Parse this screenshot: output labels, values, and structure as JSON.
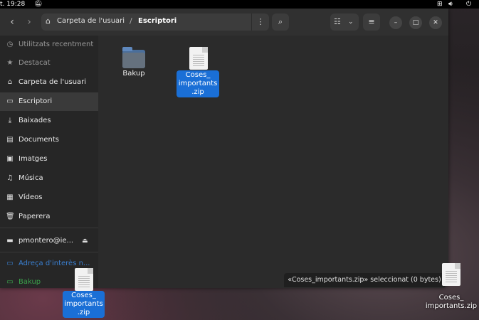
{
  "topbar": {
    "clock": "t. 19:28",
    "icons": [
      "bell-off-icon",
      "network-icon",
      "volume-icon",
      "power-icon"
    ]
  },
  "header": {
    "back_icon": "chevron-left-icon",
    "forward_icon": "chevron-right-icon",
    "breadcrumb": {
      "home_icon": "home-icon",
      "parent": "Carpeta de l'usuari",
      "separator": "/",
      "current": "Escriptori",
      "menu_icon": "kebab-icon"
    },
    "search_icon": "search-icon",
    "view_icon": "list-view-icon",
    "view_dropdown_icon": "chevron-down-icon",
    "menu_icon": "hamburger-icon",
    "window_controls": {
      "minimize": "–",
      "maximize": "□",
      "close": "✕"
    }
  },
  "sidebar": {
    "items": [
      {
        "label": "Utilitzats recentment",
        "icon": "recent-icon"
      },
      {
        "label": "Destacat",
        "icon": "star-icon"
      },
      {
        "label": "Carpeta de l'usuari",
        "icon": "home-icon"
      },
      {
        "label": "Escriptori",
        "icon": "desktop-icon"
      },
      {
        "label": "Baixades",
        "icon": "download-icon"
      },
      {
        "label": "Documents",
        "icon": "document-icon"
      },
      {
        "label": "Imatges",
        "icon": "image-icon"
      },
      {
        "label": "Música",
        "icon": "music-icon"
      },
      {
        "label": "Vídeos",
        "icon": "video-icon"
      },
      {
        "label": "Paperera",
        "icon": "trash-icon"
      }
    ],
    "mount": {
      "label": "pmontero@ie...",
      "icon": "drive-icon",
      "eject_icon": "eject-icon"
    },
    "network": {
      "label": "Adreça d'interès n...",
      "icon": "bookmark-icon"
    },
    "dropped": {
      "label": "Bakup",
      "icon": "folder-icon"
    }
  },
  "content": {
    "files": [
      {
        "name": "Bakup",
        "type": "folder"
      },
      {
        "name_lines": [
          "Coses_",
          "importants",
          ".zip"
        ],
        "type": "archive",
        "selected": true
      }
    ]
  },
  "status": "«Coses_importants.zip» seleccionat  (0 bytes)",
  "desktop": {
    "dragged_file_lines": [
      "Coses_",
      "importants",
      ".zip"
    ],
    "desktop_file_lines": [
      "Coses_",
      "importants.zip"
    ]
  },
  "colors": {
    "accent": "#1a6fd6",
    "window_bg": "#2c2c2c",
    "sidebar_bg": "#262626"
  }
}
